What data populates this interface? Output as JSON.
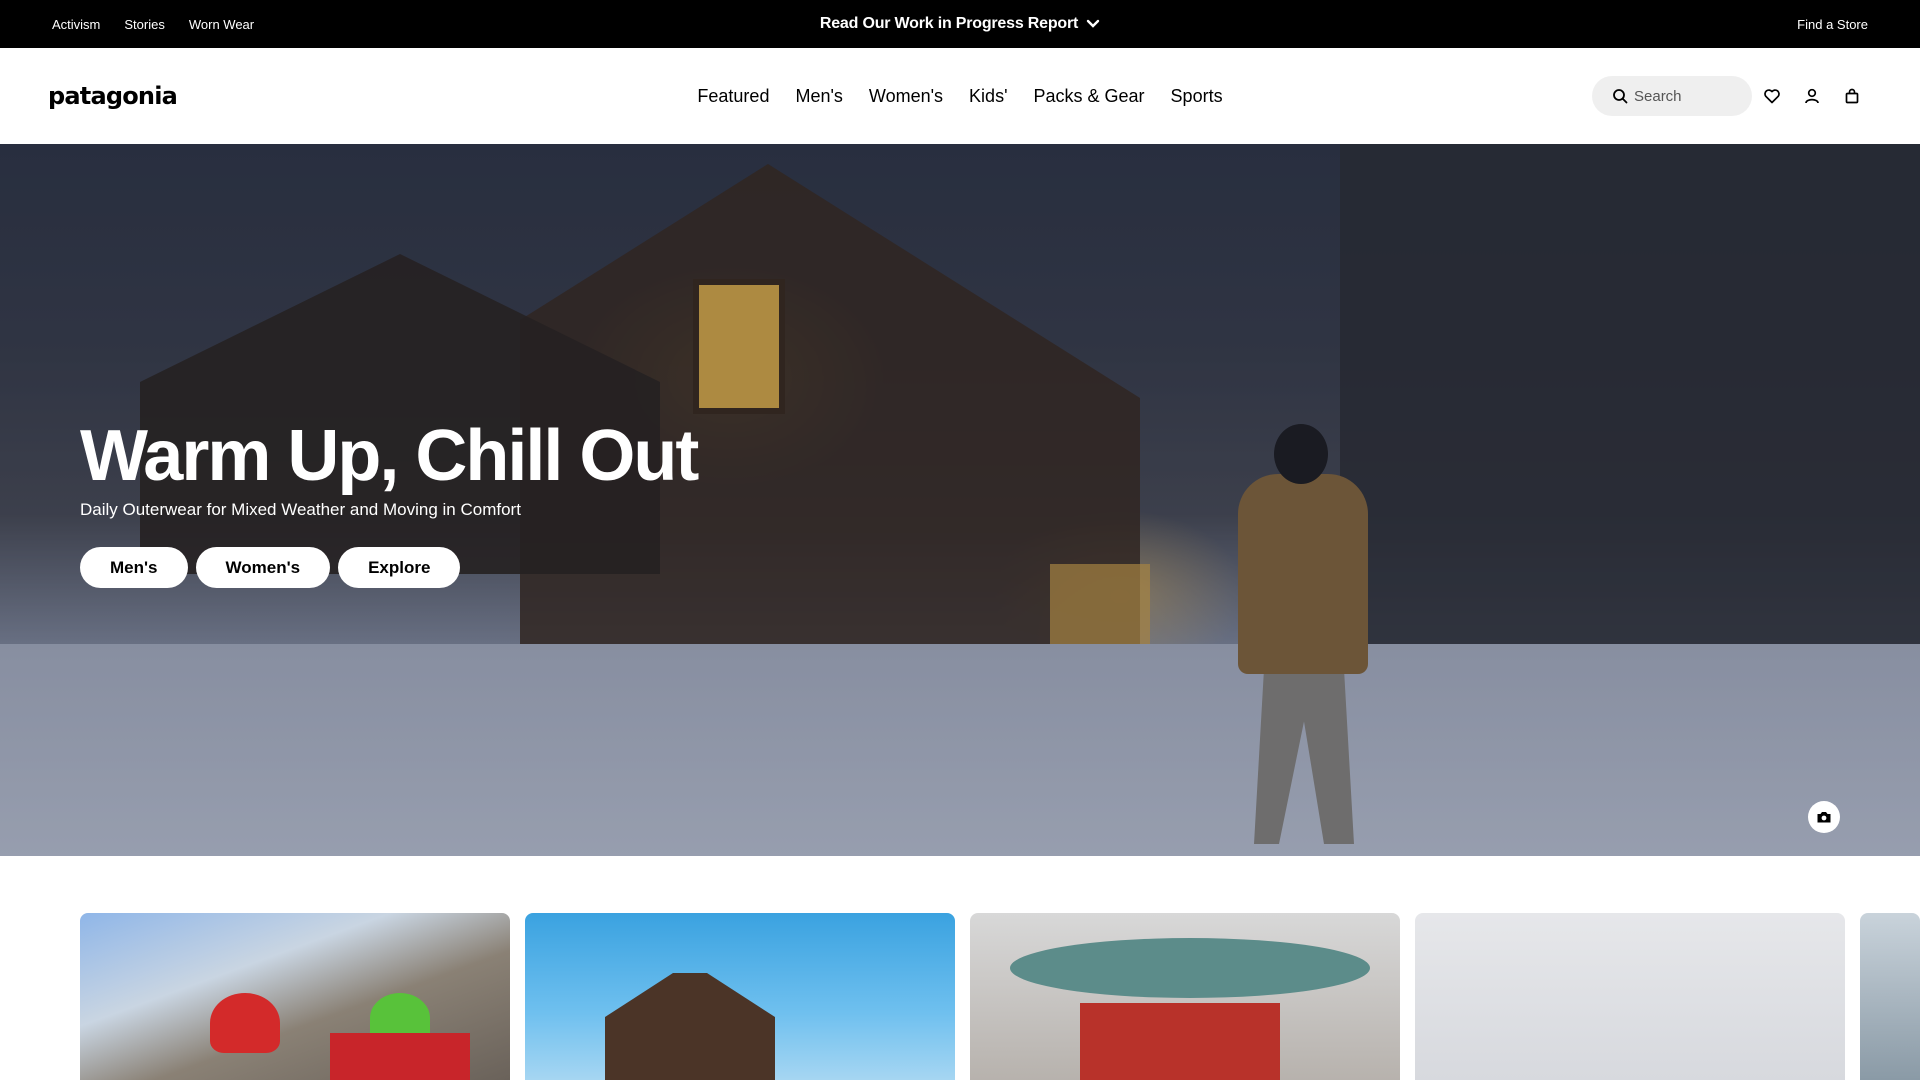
{
  "topbar": {
    "links": [
      "Activism",
      "Stories",
      "Worn Wear"
    ],
    "announcement": "Read Our Work in Progress Report",
    "find_store": "Find a Store"
  },
  "header": {
    "logo": "patagonia",
    "nav": [
      "Featured",
      "Men's",
      "Women's",
      "Kids'",
      "Packs & Gear",
      "Sports"
    ],
    "search_placeholder": "Search",
    "icons": [
      "search-icon",
      "heart-icon",
      "user-icon",
      "bag-icon"
    ]
  },
  "hero": {
    "title": "Warm Up, Chill Out",
    "subtitle": "Daily Outerwear for Mixed Weather and Moving in Comfort",
    "buttons": [
      "Men's",
      "Women's",
      "Explore"
    ],
    "icon": "camera-icon"
  },
  "cards": {
    "count_visible": 5
  },
  "colors": {
    "topbar_bg": "#000000",
    "search_bg": "#efefef",
    "button_bg": "#ffffff"
  }
}
